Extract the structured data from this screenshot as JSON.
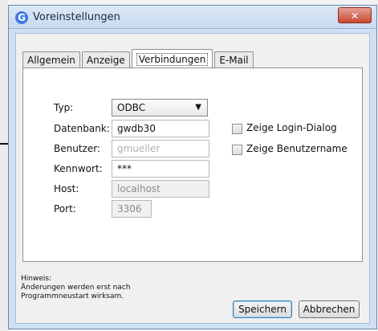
{
  "window": {
    "title": "Voreinstellungen",
    "close_glyph": "✕"
  },
  "tabs": [
    {
      "label": "Allgemein"
    },
    {
      "label": "Anzeige"
    },
    {
      "label": "Verbindungen"
    },
    {
      "label": "E-Mail"
    }
  ],
  "active_tab": "Verbindungen",
  "form": {
    "typ": {
      "label": "Typ:",
      "value": "ODBC"
    },
    "datenbank": {
      "label": "Datenbank:",
      "value": "gwdb30"
    },
    "benutzer": {
      "label": "Benutzer:",
      "value": "gmueller"
    },
    "kennwort": {
      "label": "Kennwort:",
      "value": "***"
    },
    "host": {
      "label": "Host:",
      "value": "localhost"
    },
    "port": {
      "label": "Port:",
      "value": "3306"
    }
  },
  "checkboxes": {
    "login_dialog": {
      "label": "Zeige Login-Dialog",
      "checked": false
    },
    "benutzername": {
      "label": "Zeige Benutzername",
      "checked": false
    }
  },
  "note": {
    "title": "Hinweis:",
    "line1": "Änderungen werden erst nach",
    "line2": "Programmneustart wirksam."
  },
  "buttons": {
    "save": "Speichern",
    "cancel": "Abbrechen"
  },
  "icons": {
    "app": "app-logo-icon",
    "dropdown": "chevron-down-icon",
    "close": "close-icon"
  },
  "colors": {
    "close_button": "#c94732",
    "titlebar": "#cfe0f3"
  }
}
